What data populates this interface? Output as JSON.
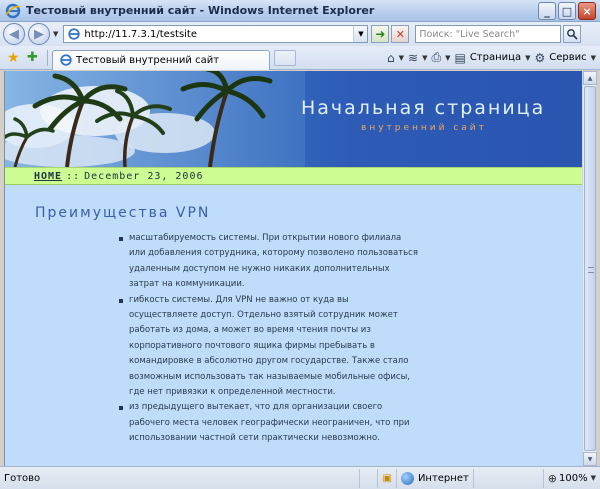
{
  "window": {
    "title": "Тестовый внутренний сайт - Windows Internet Explorer",
    "minimize": "_",
    "maximize": "□",
    "close": "×"
  },
  "address_bar": {
    "url": "http://11.7.3.1/testsite",
    "search_placeholder": "Поиск: \"Live Search\""
  },
  "tabs": [
    {
      "label": "Тестовый внутренний сайт"
    }
  ],
  "command_bar": {
    "page_label": "Страница",
    "tools_label": "Сервис"
  },
  "page": {
    "banner_title": "Начальная страница",
    "banner_subtitle": "внутренний сайт",
    "breadcrumb_home": "HOME",
    "breadcrumb_sep": "::",
    "breadcrumb_date": "December 23, 2006",
    "section_title": "Преимущества VPN",
    "bullets": [
      "масштабируемость системы. При открытии нового филиала или добавления сотрудника, которому позволено пользоваться удаленным доступом не нужно никаких дополнительных затрат на  коммуникации.",
      "гибкость системы. Для VPN не важно от куда вы осуществляете доступ. Отдельно взятый сотрудник может работать из дома, а может во время чтения почты из корпоративного почтового ящика фирмы пребывать в командировке в абсолютно другом государстве. Также стало возможным использовать так называемые мобильные офисы, где нет привязки к определенной местности.",
      "из предыдущего вытекает, что для организации своего рабочего места человек географически неограничен, что при использовании частной сети практически невозможно."
    ]
  },
  "status_bar": {
    "status": "Готово",
    "zone": "Интернет",
    "zoom": "100%"
  },
  "colors": {
    "page_background": "#bfdcfa",
    "breadcrumb_background": "#cdfc92",
    "banner_title": "#dff0ff",
    "banner_subtitle": "#f2a65a",
    "section_title": "#3a5fa8"
  }
}
